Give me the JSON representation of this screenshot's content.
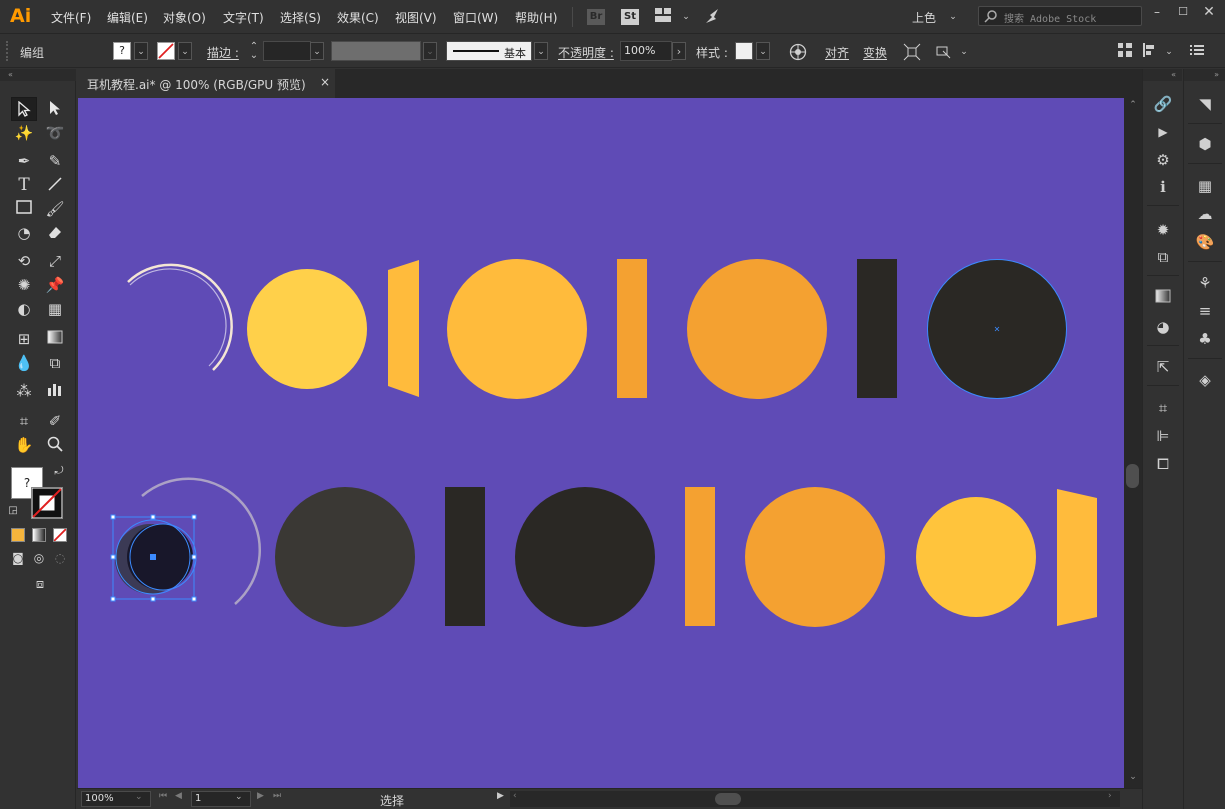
{
  "app": {
    "logo": "Ai",
    "menu": [
      "文件(F)",
      "编辑(E)",
      "对象(O)",
      "文字(T)",
      "选择(S)",
      "效果(C)",
      "视图(V)",
      "窗口(W)",
      "帮助(H)"
    ],
    "bridge_label": "Br",
    "stock_label": "St",
    "workspace": "上色",
    "stock_search_placeholder": "搜索 Adobe Stock",
    "window_buttons": [
      "minimize",
      "maximize",
      "close"
    ]
  },
  "control_bar": {
    "selection_label": "编组",
    "stroke_label": "描边 :",
    "profile_label": "基本",
    "opacity_label": "不透明度 :",
    "opacity_value": "100%",
    "style_label": "样式 :",
    "align_label": "对齐",
    "transform_label": "变换"
  },
  "document": {
    "tab_title": "耳机教程.ai* @ 100% (RGB/GPU 预览)",
    "close_glyph": "×"
  },
  "status": {
    "zoom": "100%",
    "page": "1",
    "mode": "选择"
  },
  "colors": {
    "artboard": "#5f4bb6",
    "yellow": "#ffd04a",
    "amber": "#ffbb3c",
    "orange": "#f4a131",
    "dark": "#2a2824",
    "dark2": "#3a3834",
    "selection": "#3c8bff"
  },
  "tools": [
    "selection-tool",
    "direct-selection-tool",
    "magic-wand-tool",
    "lasso-tool",
    "pen-tool",
    "curvature-tool",
    "type-tool",
    "line-tool",
    "rectangle-tool",
    "paintbrush-tool",
    "shaper-tool",
    "eraser-tool",
    "rotate-tool",
    "scale-tool",
    "puppet-warp-tool",
    "free-transform-tool",
    "shape-builder-tool",
    "perspective-grid-tool",
    "mesh-tool",
    "gradient-tool",
    "eyedropper-tool",
    "blend-tool",
    "symbol-sprayer-tool",
    "column-graph-tool",
    "artboard-tool",
    "slice-tool",
    "hand-tool",
    "zoom-tool"
  ]
}
